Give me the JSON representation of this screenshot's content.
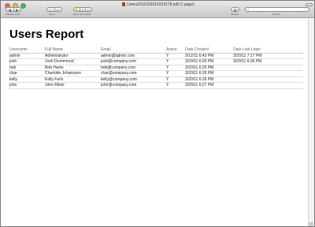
{
  "window": {
    "title": "Users2011032915223178.pdf (1 page)",
    "colors": {
      "close": "#ff5f57",
      "minimize": "#febc2e",
      "zoom": "#28c840"
    }
  },
  "toolbar": {
    "previous_next": {
      "prev_glyph": "◀",
      "next_glyph": "▶",
      "label": "Previous   Next"
    },
    "zoom": {
      "out_glyph": "−",
      "in_glyph": "+",
      "label": "Zoom"
    },
    "tools": {
      "label": "Move  Text  Select"
    },
    "sidebar": {
      "label": "Sidebar"
    },
    "search": {
      "label": "Search",
      "placeholder": "",
      "value": ""
    }
  },
  "report": {
    "title": "Users Report",
    "columns": [
      "Username",
      "Full Name",
      "Email",
      "Active",
      "Date Created",
      "Date Last Login"
    ],
    "rows": [
      [
        "admin",
        "Administrator",
        "admin@admin.com",
        "Y",
        "3/12/11 6:43 PM",
        "3/20/11 7:17 PM"
      ],
      [
        "josh",
        "Josh Drummond",
        "josh@company.com",
        "Y",
        "3/20/11 6:20 PM",
        "3/20/11 6:36 PM"
      ],
      [
        "bob",
        "Bob Harris",
        "bob@company.com",
        "Y",
        "3/20/11 6:25 PM",
        ""
      ],
      [
        "char",
        "Charlotte Johansson",
        "char@company.com",
        "Y",
        "3/20/11 6:26 PM",
        ""
      ],
      [
        "kelly",
        "Kelly Faris",
        "kelly@company.com",
        "Y",
        "3/20/11 6:26 PM",
        ""
      ],
      [
        "john",
        "John Ribisi",
        "john@company.com",
        "Y",
        "3/20/11 6:27 PM",
        ""
      ]
    ]
  }
}
